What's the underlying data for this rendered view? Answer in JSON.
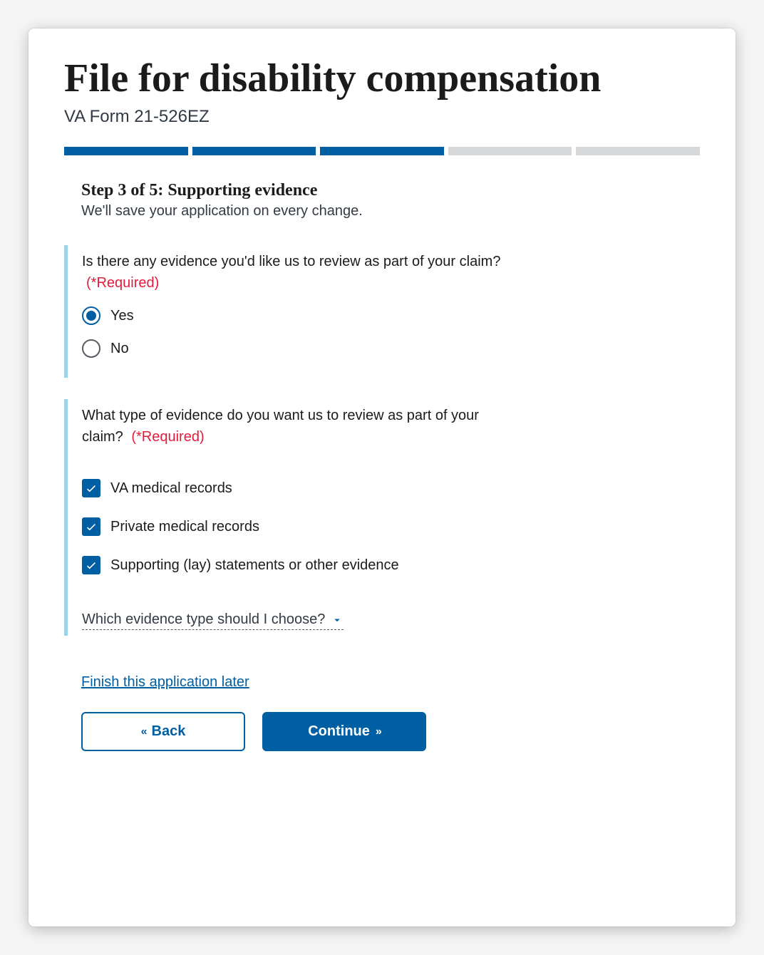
{
  "header": {
    "title": "File for disability compensation",
    "form_id": "VA Form 21-526EZ"
  },
  "progress": {
    "total": 5,
    "completed": 3
  },
  "step": {
    "heading": "Step 3 of 5: Supporting evidence",
    "save_note": "We'll save your application on every change."
  },
  "q1": {
    "text": "Is there any evidence you'd like us to review as part of your claim?",
    "required_text": "(*Required)",
    "options": {
      "yes": "Yes",
      "no": "No"
    },
    "selected": "yes"
  },
  "q2": {
    "text": "What type of evidence do you want us to review as part of your claim?",
    "required_text": "(*Required)",
    "options": [
      {
        "label": "VA medical records",
        "checked": true
      },
      {
        "label": "Private medical records",
        "checked": true
      },
      {
        "label": "Supporting (lay) statements or other evidence",
        "checked": true
      }
    ]
  },
  "disclosure": {
    "label": "Which evidence type should I choose?"
  },
  "links": {
    "finish_later": "Finish this application later"
  },
  "buttons": {
    "back": "Back",
    "continue": "Continue"
  }
}
